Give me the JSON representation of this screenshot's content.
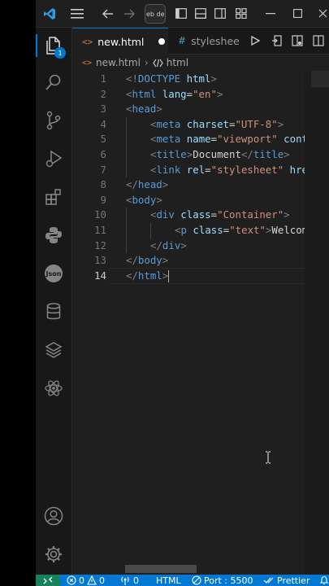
{
  "titlebar": {
    "search_text": "eb de"
  },
  "activity": {
    "explorer_badge": "1"
  },
  "tabs": [
    {
      "label": "new.html",
      "active": true,
      "dirty": true
    },
    {
      "label": "styleshee",
      "active": false
    }
  ],
  "breadcrumb": {
    "file": "new.html",
    "symbol": "html"
  },
  "editor": {
    "current_line": 14,
    "lines": [
      {
        "n": "1",
        "indent": 0,
        "tokens": [
          [
            "t-punc",
            "<!"
          ],
          [
            "t-tag",
            "DOCTYPE"
          ],
          [
            "t-txt",
            " "
          ],
          [
            "t-attr",
            "html"
          ],
          [
            "t-punc",
            ">"
          ]
        ]
      },
      {
        "n": "2",
        "indent": 0,
        "tokens": [
          [
            "t-punc",
            "<"
          ],
          [
            "t-tag",
            "html"
          ],
          [
            "t-txt",
            " "
          ],
          [
            "t-attr",
            "lang"
          ],
          [
            "t-txt",
            "="
          ],
          [
            "t-str",
            "\"en\""
          ],
          [
            "t-punc",
            ">"
          ]
        ]
      },
      {
        "n": "3",
        "indent": 0,
        "tokens": [
          [
            "t-punc",
            "<"
          ],
          [
            "t-tag",
            "head"
          ],
          [
            "t-punc",
            ">"
          ]
        ]
      },
      {
        "n": "4",
        "indent": 1,
        "tokens": [
          [
            "t-punc",
            "<"
          ],
          [
            "t-tag",
            "meta"
          ],
          [
            "t-txt",
            " "
          ],
          [
            "t-attr",
            "charset"
          ],
          [
            "t-txt",
            "="
          ],
          [
            "t-str",
            "\"UTF-8\""
          ],
          [
            "t-punc",
            ">"
          ]
        ]
      },
      {
        "n": "5",
        "indent": 1,
        "tokens": [
          [
            "t-punc",
            "<"
          ],
          [
            "t-tag",
            "meta"
          ],
          [
            "t-txt",
            " "
          ],
          [
            "t-attr",
            "name"
          ],
          [
            "t-txt",
            "="
          ],
          [
            "t-str",
            "\"viewport\""
          ],
          [
            "t-txt",
            " "
          ],
          [
            "t-attr",
            "cont"
          ]
        ]
      },
      {
        "n": "6",
        "indent": 1,
        "tokens": [
          [
            "t-punc",
            "<"
          ],
          [
            "t-tag",
            "title"
          ],
          [
            "t-punc",
            ">"
          ],
          [
            "t-txt",
            "Document"
          ],
          [
            "t-punc",
            "</"
          ],
          [
            "t-tag",
            "title"
          ],
          [
            "t-punc",
            ">"
          ]
        ]
      },
      {
        "n": "7",
        "indent": 1,
        "tokens": [
          [
            "t-punc",
            "<"
          ],
          [
            "t-tag",
            "link"
          ],
          [
            "t-txt",
            " "
          ],
          [
            "t-attr",
            "rel"
          ],
          [
            "t-txt",
            "="
          ],
          [
            "t-str",
            "\"stylesheet\""
          ],
          [
            "t-txt",
            " "
          ],
          [
            "t-attr",
            "hre"
          ]
        ]
      },
      {
        "n": "8",
        "indent": 0,
        "tokens": [
          [
            "t-punc",
            "</"
          ],
          [
            "t-tag",
            "head"
          ],
          [
            "t-punc",
            ">"
          ]
        ]
      },
      {
        "n": "9",
        "indent": 0,
        "tokens": [
          [
            "t-punc",
            "<"
          ],
          [
            "t-tag",
            "body"
          ],
          [
            "t-punc",
            ">"
          ]
        ]
      },
      {
        "n": "10",
        "indent": 1,
        "tokens": [
          [
            "t-punc",
            "<"
          ],
          [
            "t-tag",
            "div"
          ],
          [
            "t-txt",
            " "
          ],
          [
            "t-attr",
            "class"
          ],
          [
            "t-txt",
            "="
          ],
          [
            "t-str",
            "\"Container\""
          ],
          [
            "t-punc",
            ">"
          ]
        ]
      },
      {
        "n": "11",
        "indent": 2,
        "tokens": [
          [
            "t-punc",
            "<"
          ],
          [
            "t-tag",
            "p"
          ],
          [
            "t-txt",
            " "
          ],
          [
            "t-attr",
            "class"
          ],
          [
            "t-txt",
            "="
          ],
          [
            "t-str",
            "\"text\""
          ],
          [
            "t-punc",
            ">"
          ],
          [
            "t-txt",
            "Welcom"
          ]
        ]
      },
      {
        "n": "12",
        "indent": 1,
        "tokens": [
          [
            "t-punc",
            "</"
          ],
          [
            "t-tag",
            "div"
          ],
          [
            "t-punc",
            ">"
          ]
        ]
      },
      {
        "n": "13",
        "indent": 0,
        "tokens": [
          [
            "t-punc",
            "</"
          ],
          [
            "t-tag",
            "body"
          ],
          [
            "t-punc",
            ">"
          ]
        ]
      },
      {
        "n": "14",
        "indent": 0,
        "tokens": [
          [
            "t-punc",
            "</"
          ],
          [
            "t-tag",
            "html"
          ],
          [
            "t-punc",
            ">"
          ]
        ]
      }
    ]
  },
  "statusbar": {
    "errors": "0",
    "warnings": "0",
    "ports": "0",
    "language": "HTML",
    "port": "Port : 5500",
    "formatter": "Prettier"
  },
  "colors": {
    "accent": "#0078d4",
    "status_bg": "#0078d4",
    "remote_bg": "#16825d",
    "editor_bg": "#1f1f1f",
    "tag": "#569cd6",
    "attr": "#9cdcfe",
    "string": "#ce9178"
  }
}
